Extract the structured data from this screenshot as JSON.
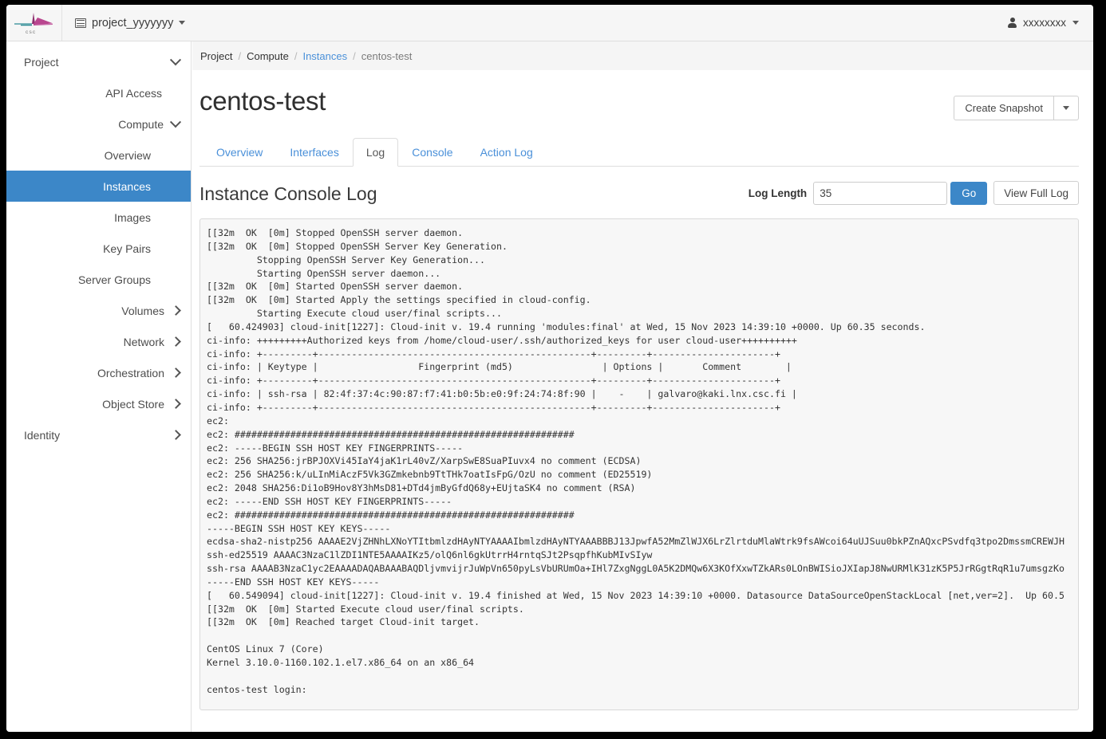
{
  "navbar": {
    "logo_alt": "csc",
    "logo_text": "csc",
    "project_label": "project_yyyyyyy",
    "user_label": "xxxxxxxx"
  },
  "sidebar": {
    "items": [
      {
        "label": "Project",
        "level": 0,
        "chevron": "down",
        "active": false
      },
      {
        "label": "API Access",
        "level": 1,
        "chevron": "none",
        "active": false
      },
      {
        "label": "Compute",
        "level": 1,
        "chevron": "down",
        "active": false
      },
      {
        "label": "Overview",
        "level": 2,
        "chevron": "none",
        "active": false
      },
      {
        "label": "Instances",
        "level": 2,
        "chevron": "none",
        "active": true
      },
      {
        "label": "Images",
        "level": 2,
        "chevron": "none",
        "active": false
      },
      {
        "label": "Key Pairs",
        "level": 2,
        "chevron": "none",
        "active": false
      },
      {
        "label": "Server Groups",
        "level": 2,
        "chevron": "none",
        "active": false
      },
      {
        "label": "Volumes",
        "level": 1,
        "chevron": "right",
        "active": false
      },
      {
        "label": "Network",
        "level": 1,
        "chevron": "right",
        "active": false
      },
      {
        "label": "Orchestration",
        "level": 1,
        "chevron": "right",
        "active": false
      },
      {
        "label": "Object Store",
        "level": 1,
        "chevron": "right",
        "active": false
      },
      {
        "label": "Identity",
        "level": 0,
        "chevron": "right",
        "active": false
      }
    ]
  },
  "breadcrumb": [
    {
      "label": "Project",
      "type": "plain"
    },
    {
      "label": "Compute",
      "type": "plain"
    },
    {
      "label": "Instances",
      "type": "link"
    },
    {
      "label": "centos-test",
      "type": "current"
    }
  ],
  "page": {
    "title": "centos-test",
    "create_snapshot_label": "Create Snapshot",
    "snapshot_dropdown_icon": "caret-down-icon"
  },
  "tabs": [
    {
      "label": "Overview",
      "active": false
    },
    {
      "label": "Interfaces",
      "active": false
    },
    {
      "label": "Log",
      "active": true
    },
    {
      "label": "Console",
      "active": false
    },
    {
      "label": "Action Log",
      "active": false
    }
  ],
  "log_section": {
    "title": "Instance Console Log",
    "log_length_label": "Log Length",
    "log_length_value": "35",
    "log_length_placeholder": "",
    "go_label": "Go",
    "view_full_log_label": "View Full Log",
    "content": "[[32m  OK  [0m] Stopped OpenSSH server daemon.\n[[32m  OK  [0m] Stopped OpenSSH Server Key Generation.\n         Stopping OpenSSH Server Key Generation...\n         Starting OpenSSH server daemon...\n[[32m  OK  [0m] Started OpenSSH server daemon.\n[[32m  OK  [0m] Started Apply the settings specified in cloud-config.\n         Starting Execute cloud user/final scripts...\n[   60.424903] cloud-init[1227]: Cloud-init v. 19.4 running 'modules:final' at Wed, 15 Nov 2023 14:39:10 +0000. Up 60.35 seconds.\nci-info: +++++++++Authorized keys from /home/cloud-user/.ssh/authorized_keys for user cloud-user++++++++++\nci-info: +---------+-------------------------------------------------+---------+----------------------+\nci-info: | Keytype |                  Fingerprint (md5)                | Options |       Comment        |\nci-info: +---------+-------------------------------------------------+---------+----------------------+\nci-info: | ssh-rsa | 82:4f:37:4c:90:87:f7:41:b0:5b:e0:9f:24:74:8f:90 |    -    | galvaro@kaki.lnx.csc.fi |\nci-info: +---------+-------------------------------------------------+---------+----------------------+\nec2:\nec2: #############################################################\nec2: -----BEGIN SSH HOST KEY FINGERPRINTS-----\nec2: 256 SHA256:jrBPJOXVi45IaY4jaK1rL40vZ/XarpSwE8SuaPIuvx4 no comment (ECDSA)\nec2: 256 SHA256:k/uLInMiAczF5Vk3GZmkebnb9TtTHk7oatIsFpG/OzU no comment (ED25519)\nec2: 2048 SHA256:Di1oB9Hov8Y3hMsD81+DTd4jmByGfdQ68y+EUjtaSK4 no comment (RSA)\nec2: -----END SSH HOST KEY FINGERPRINTS-----\nec2: #############################################################\n-----BEGIN SSH HOST KEY KEYS-----\necdsa-sha2-nistp256 AAAAE2VjZHNhLXNoYTItbmlzdHAyNTYAAAAIbmlzdHAyNTYAAABBBJ13JpwfA52MmZlWJX6LrZlrtduMlaWtrk9fsAWcoi64uUJSuu0bkPZnAQxcPSvdfq3tpo2DmssmCREWJH\nssh-ed25519 AAAAC3NzaC1lZDI1NTE5AAAAIKz5/olQ6nl6gkUtrrH4rntqSJt2PsqpfhKubMIvSIyw\nssh-rsa AAAAB3NzaC1yc2EAAAADAQABAAABAQDljvmvijrJuWpVn650pyLsVbURUmOa+IHl7ZxgNggL0A5K2DMQw6X3KOfXxwTZkARs0LOnBWISioJXIapJ8NwURMlK31zK5P5JrRGgtRqR1u7umsgzKo\n-----END SSH HOST KEY KEYS-----\n[   60.549094] cloud-init[1227]: Cloud-init v. 19.4 finished at Wed, 15 Nov 2023 14:39:10 +0000. Datasource DataSourceOpenStackLocal [net,ver=2].  Up 60.5\n[[32m  OK  [0m] Started Execute cloud user/final scripts.\n[[32m  OK  [0m] Reached target Cloud-init target.\n\nCentOS Linux 7 (Core)\nKernel 3.10.0-1160.102.1.el7.x86_64 on an x86_64\n\ncentos-test login: "
  },
  "colors": {
    "accent": "#3c87c8",
    "link": "#4a90d9",
    "panel_bg": "#f7f7f7",
    "logo_teal": "#2a8a92",
    "logo_magenta": "#b23a7a"
  }
}
